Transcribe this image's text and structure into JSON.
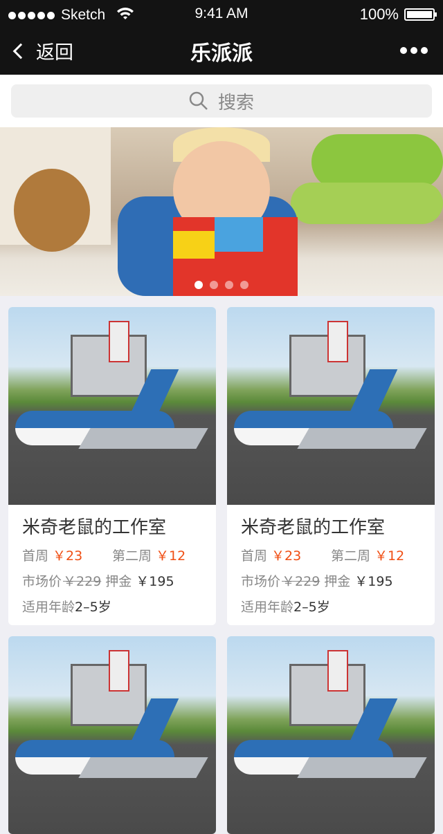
{
  "status": {
    "carrier": "Sketch",
    "time": "9:41 AM",
    "battery": "100%"
  },
  "nav": {
    "back": "返回",
    "title": "乐派派",
    "more_icon": "more-dots-icon"
  },
  "search": {
    "placeholder": "搜索"
  },
  "banner": {
    "slides": 4,
    "active": 0
  },
  "products": [
    {
      "name": "米奇老鼠的工作室",
      "first_label": "首周",
      "first_price": "￥23",
      "second_label": "第二周",
      "second_price": "￥12",
      "market_label": "市场价",
      "market_price": "￥229",
      "deposit_label": "押金",
      "deposit": "￥195",
      "age_label": "适用年龄",
      "age": "2–5岁"
    },
    {
      "name": "米奇老鼠的工作室",
      "first_label": "首周",
      "first_price": "￥23",
      "second_label": "第二周",
      "second_price": "￥12",
      "market_label": "市场价",
      "market_price": "￥229",
      "deposit_label": "押金",
      "deposit": "￥195",
      "age_label": "适用年龄",
      "age": "2–5岁"
    }
  ],
  "colors": {
    "accent": "#f04e13",
    "nav_bg": "#131313"
  }
}
